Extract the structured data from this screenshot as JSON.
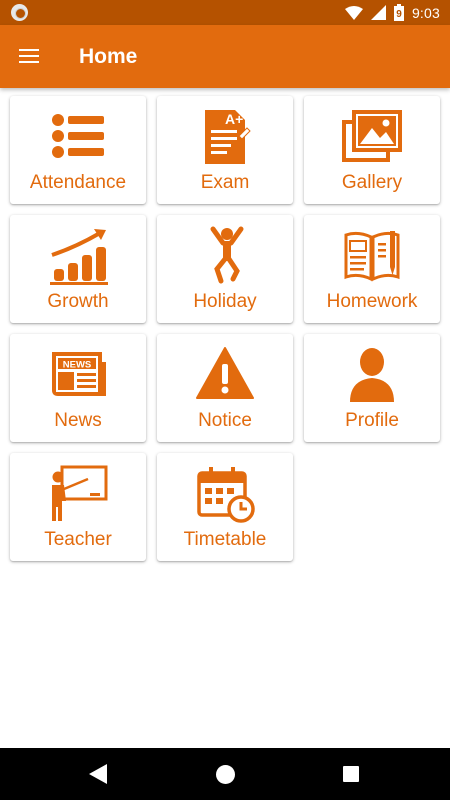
{
  "status_bar": {
    "time": "9:03",
    "battery_level": "9",
    "icons": [
      "notification-icon",
      "wifi-icon",
      "signal-icon",
      "battery-icon"
    ]
  },
  "app_bar": {
    "title": "Home",
    "menu_icon": "menu-icon",
    "background": "#e26b0e"
  },
  "accent_color": "#e26b0e",
  "tiles": [
    {
      "label": "Attendance",
      "icon": "list-icon"
    },
    {
      "label": "Exam",
      "icon": "exam-grade-icon"
    },
    {
      "label": "Gallery",
      "icon": "gallery-icon"
    },
    {
      "label": "Growth",
      "icon": "growth-chart-icon"
    },
    {
      "label": "Holiday",
      "icon": "jumping-person-icon"
    },
    {
      "label": "Homework",
      "icon": "book-pencil-icon"
    },
    {
      "label": "News",
      "icon": "newspaper-icon"
    },
    {
      "label": "Notice",
      "icon": "warning-icon"
    },
    {
      "label": "Profile",
      "icon": "user-icon"
    },
    {
      "label": "Teacher",
      "icon": "teacher-board-icon"
    },
    {
      "label": "Timetable",
      "icon": "calendar-clock-icon"
    }
  ],
  "nav_bar": {
    "buttons": [
      "back-icon",
      "home-icon",
      "recent-apps-icon"
    ]
  }
}
